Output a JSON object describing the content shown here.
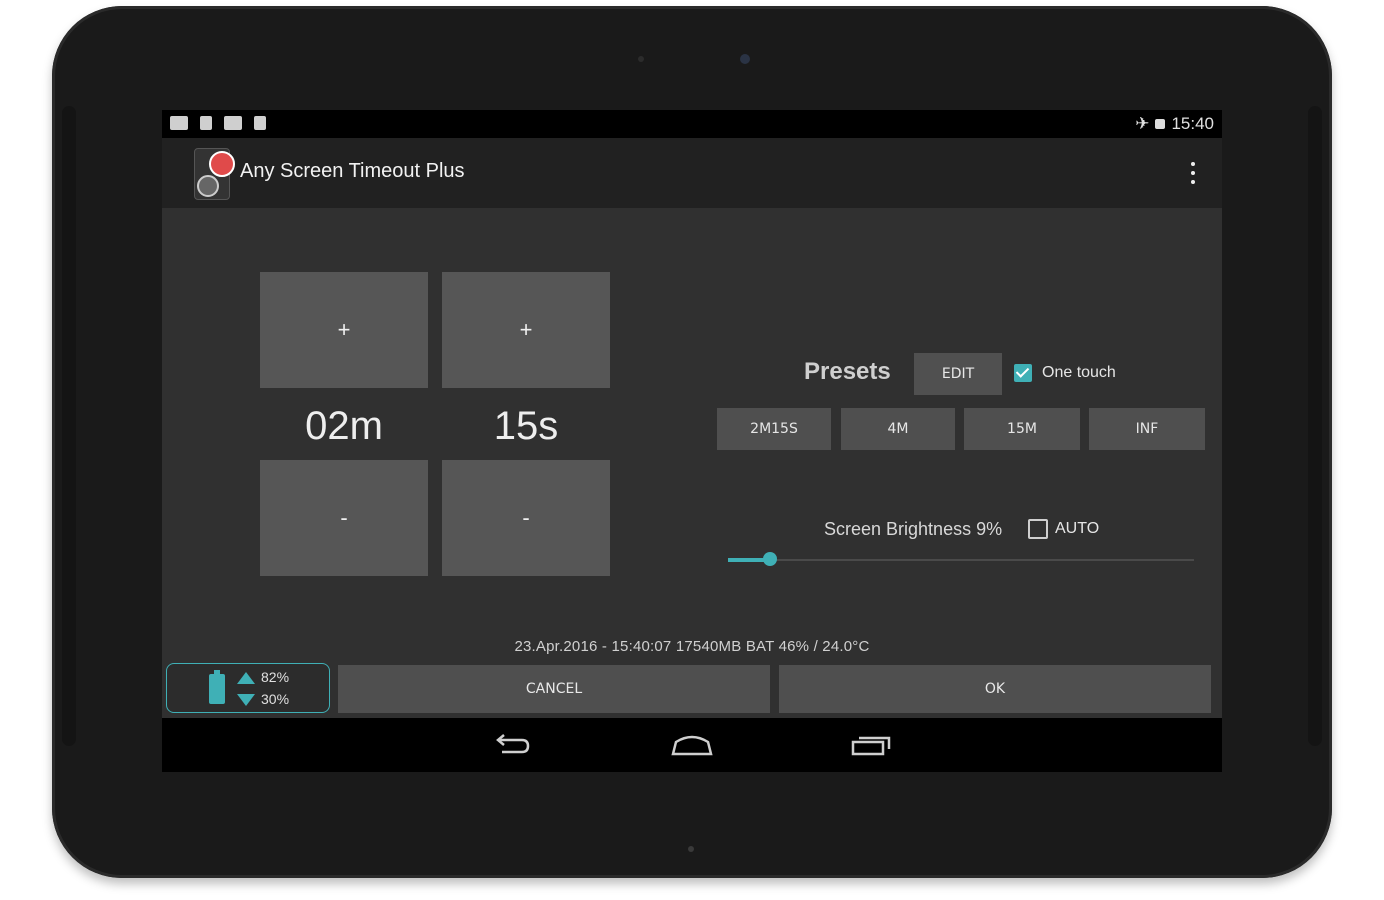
{
  "statusbar": {
    "time": "15:40"
  },
  "actionbar": {
    "title": "Any Screen Timeout Plus"
  },
  "timer": {
    "minutes": "02m",
    "seconds": "15s",
    "plus_label": "+",
    "minus_label": "-"
  },
  "presets": {
    "label": "Presets",
    "edit_label": "EDIT",
    "one_touch_label": "One touch",
    "one_touch_checked": true,
    "items": [
      "2M15S",
      "4M",
      "15M",
      "INF"
    ]
  },
  "brightness": {
    "label": "Screen Brightness 9%",
    "auto_label": "AUTO",
    "auto_checked": false,
    "level_percent": 9
  },
  "info_line": "23.Apr.2016 - 15:40:07   17540MB   BAT 46% / 24.0°C",
  "battery_widget": {
    "upper": "82%",
    "lower": "30%"
  },
  "buttons": {
    "cancel": "CANCEL",
    "ok": "OK"
  },
  "colors": {
    "accent": "#3fb0b6",
    "background": "#303030",
    "button": "#565656"
  }
}
